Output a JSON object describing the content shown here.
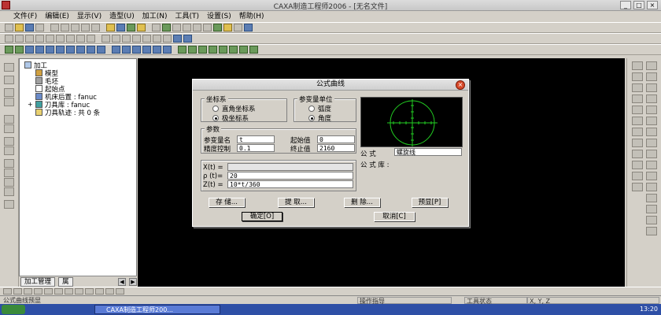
{
  "window": {
    "title": "CAXA制造工程师2006 - [无名文件]",
    "controls": [
      "_",
      "□",
      "×"
    ]
  },
  "menu": [
    "文件(F)",
    "编辑(E)",
    "显示(V)",
    "造型(U)",
    "加工(N)",
    "工具(T)",
    "设置(S)",
    "帮助(H)"
  ],
  "tree": {
    "root": "加工",
    "items": [
      "模型",
      "毛坯",
      "起始点",
      "机床后置 : fanuc",
      "刀具库 : fanuc",
      "刀具轨迹 : 共 0 条"
    ],
    "tabs": [
      "加工管理",
      "属"
    ]
  },
  "dialog": {
    "title": "公式曲线",
    "coord_group": "坐标系",
    "coord_options": [
      "直角坐标系",
      "极坐标系"
    ],
    "coord_selected": 1,
    "unit_group": "参变量单位",
    "unit_options": [
      "弧度",
      "角度"
    ],
    "unit_selected": 1,
    "params_group": "参数",
    "param_name_label": "参变量名",
    "param_name_value": "t",
    "start_label": "起始值",
    "start_value": "0",
    "precision_label": "精度控制",
    "precision_value": "0.1",
    "end_label": "终止值",
    "end_value": "2160",
    "formula_label": "公 式",
    "formula_value": "螺旋线",
    "library_label": "公 式 库 :",
    "x_label": "X(t) =",
    "x_value": "",
    "p_label": "ρ (t)=",
    "p_value": "20",
    "z_label": "Z(t) =",
    "z_value": "10*t/360",
    "btn_save": "存 储...",
    "btn_extract": "提 取...",
    "btn_delete": "删 除...",
    "btn_preview": "预显[P]",
    "btn_ok": "确定[O]",
    "btn_cancel": "取消[C]"
  },
  "status": {
    "left": "公式曲线预显",
    "middle": "操作指导",
    "tool": "工具状态",
    "coords": "X, Y, Z"
  },
  "taskbar": {
    "task": "CAXA制造工程师200...",
    "clock": "13:20"
  },
  "colors": {
    "canvas": "#000000",
    "preview_curve": "#22cc22",
    "dialog_close": "#d84a2a"
  }
}
